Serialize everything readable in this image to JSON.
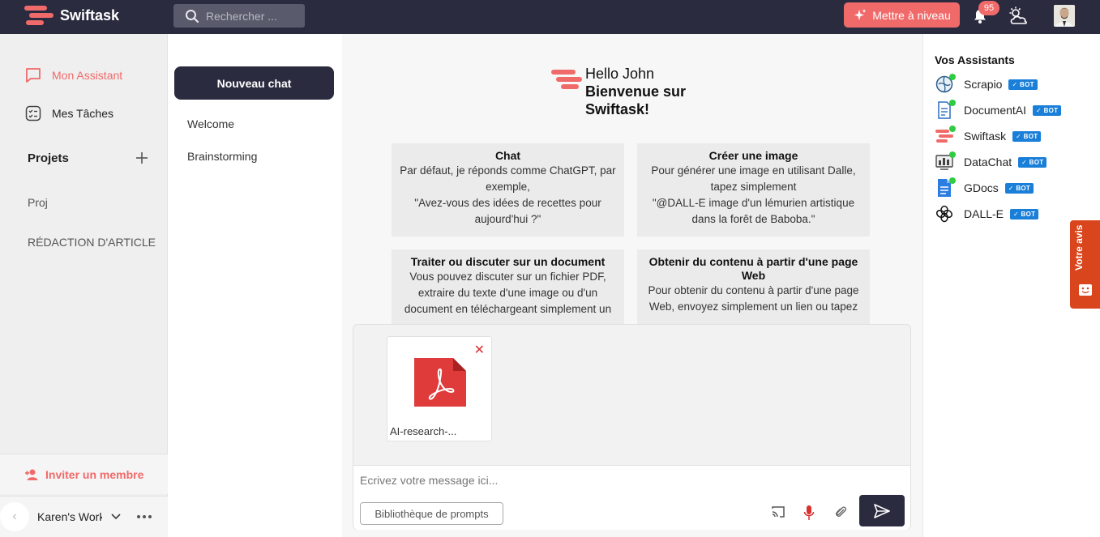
{
  "header": {
    "brand": "Swiftask",
    "search_placeholder": "Rechercher ...",
    "upgrade_label": "Mettre à niveau",
    "notification_count": "95"
  },
  "sidebar": {
    "items": [
      {
        "label": "Mon Assistant"
      },
      {
        "label": "Mes Tâches"
      }
    ],
    "projects_title": "Projets",
    "projects": [
      "Proj",
      "RÉDACTION D'ARTICLE"
    ],
    "invite_label": "Inviter un membre",
    "workspace_name": "Karen's Work"
  },
  "chatlist": {
    "new_chat_label": "Nouveau chat",
    "chats": [
      "Welcome",
      "Brainstorming"
    ]
  },
  "main": {
    "greeting": "Hello John",
    "welcome_line1": "Bienvenue sur",
    "welcome_line2": "Swiftask!",
    "cards": [
      {
        "title": "Chat",
        "body": "Par défaut, je réponds comme ChatGPT, par exemple,\n\"Avez-vous des idées de recettes pour aujourd'hui ?\""
      },
      {
        "title": "Créer une image",
        "body": "Pour générer une image en utilisant Dalle, tapez simplement\n\"@DALL-E image d'un lémurien artistique dans la forêt de Baboba.\""
      },
      {
        "title": "Traiter ou discuter sur un document",
        "body": "Vous pouvez discuter sur un fichier PDF, extraire du texte d'une image ou d'un document en téléchargeant simplement un"
      },
      {
        "title": "Obtenir du contenu à partir d'une page Web",
        "body": "Pour obtenir du contenu à partir d'une page Web, envoyez simplement un lien ou tapez"
      }
    ]
  },
  "composer": {
    "attachment_name": "AI-research-...",
    "message_placeholder": "Ecrivez votre message ici...",
    "prompts_label": "Bibliothèque de prompts"
  },
  "rightbar": {
    "title": "Vos Assistants",
    "badge_label": "✓ BOT",
    "assistants": [
      {
        "name": "Scrapio"
      },
      {
        "name": "DocumentAI"
      },
      {
        "name": "Swiftask"
      },
      {
        "name": "DataChat"
      },
      {
        "name": "GDocs"
      },
      {
        "name": "DALL-E"
      }
    ]
  },
  "feedback_label": "Votre avis",
  "colors": {
    "accent": "#f16a6a",
    "dark": "#2b2b40",
    "bot_badge": "#1a7fd8",
    "online": "#2ecc40",
    "feedback": "#d9451c"
  }
}
